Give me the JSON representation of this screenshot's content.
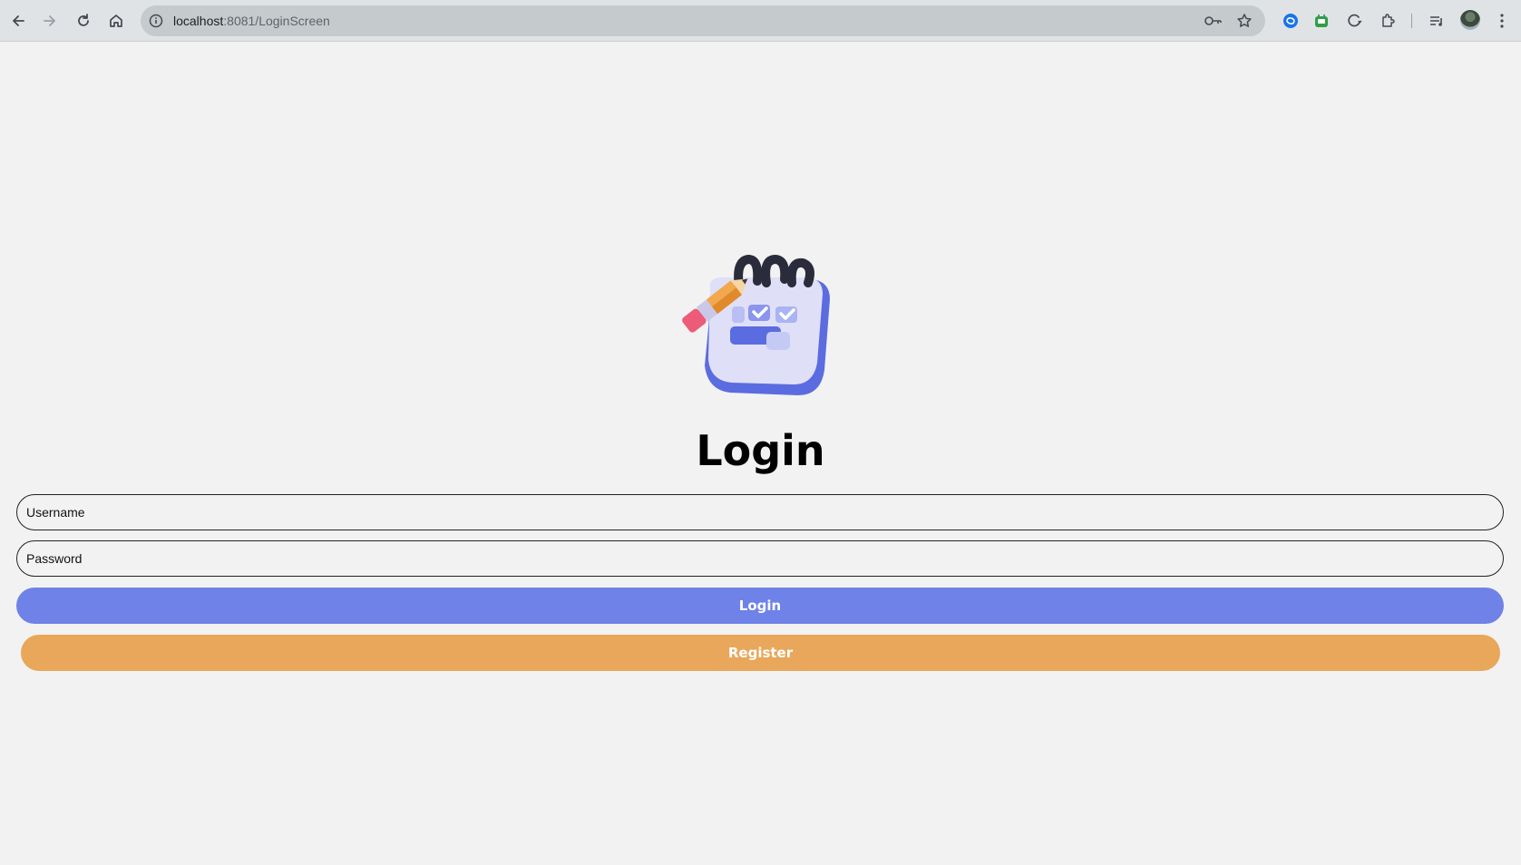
{
  "browser": {
    "url_host": "localhost",
    "url_path": ":8081/LoginScreen",
    "icons": [
      "back-icon",
      "forward-icon",
      "reload-icon",
      "home-icon",
      "site-info-icon",
      "password-key-icon",
      "bookmark-star-icon",
      "extension-blue-icon",
      "extension-green-icon",
      "extension-refresh-icon",
      "extensions-puzzle-icon",
      "media-control-icon",
      "profile-avatar",
      "more-menu-icon"
    ]
  },
  "page": {
    "title": "Login",
    "username_placeholder": "Username",
    "password_placeholder": "Password",
    "login_label": "Login",
    "register_label": "Register"
  },
  "colors": {
    "background": "#f2f2f2",
    "login_button": "#6e82e8",
    "register_button": "#e8a75a",
    "field_border": "#222222"
  }
}
